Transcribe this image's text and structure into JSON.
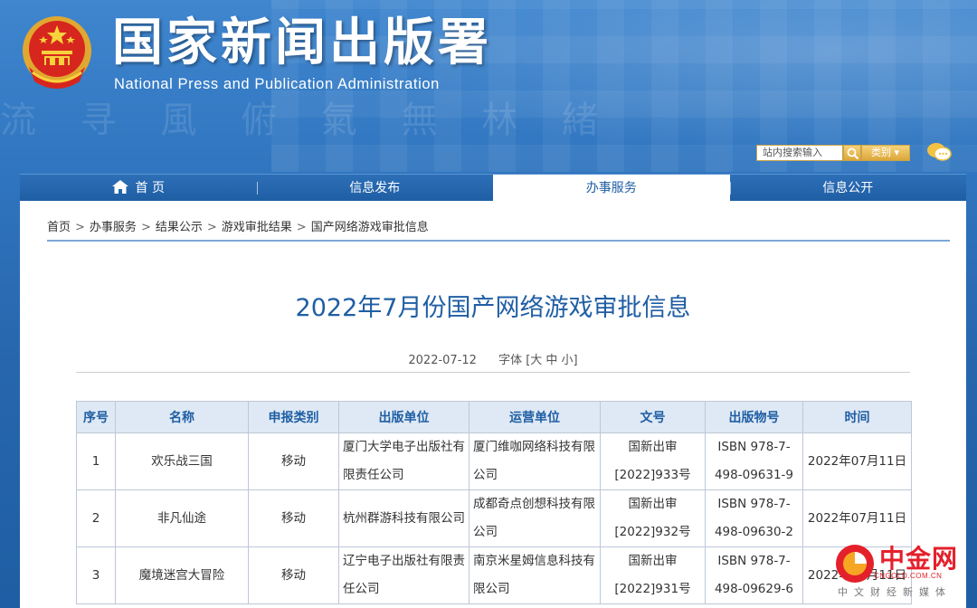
{
  "header": {
    "site_title": "国家新闻出版署",
    "site_subtitle": "National Press and Publication Administration",
    "search_placeholder": "站内搜索输入",
    "category_label": "类别 ▾"
  },
  "nav": {
    "items": [
      {
        "label": "首 页"
      },
      {
        "label": "信息发布"
      },
      {
        "label": "办事服务"
      },
      {
        "label": "信息公开"
      }
    ],
    "active_index": 2
  },
  "breadcrumb": [
    "首页",
    "办事服务",
    "结果公示",
    "游戏审批结果",
    "国产网络游戏审批信息"
  ],
  "breadcrumb_sep": ">",
  "article": {
    "title": "2022年7月份国产网络游戏审批信息",
    "date": "2022-07-12",
    "font_label": "字体 [大 中 小]"
  },
  "table": {
    "headers": [
      "序号",
      "名称",
      "申报类别",
      "出版单位",
      "运营单位",
      "文号",
      "出版物号",
      "时间"
    ],
    "rows": [
      [
        "1",
        "欢乐战三国",
        "移动",
        "厦门大学电子出版社有限责任公司",
        "厦门维咖网络科技有限公司",
        "国新出审[2022]933号",
        "ISBN 978-7-498-09631-9",
        "2022年07月11日"
      ],
      [
        "2",
        "非凡仙途",
        "移动",
        "杭州群游科技有限公司",
        "成都奇点创想科技有限公司",
        "国新出审[2022]932号",
        "ISBN 978-7-498-09630-2",
        "2022年07月11日"
      ],
      [
        "3",
        "魔境迷宫大冒险",
        "移动",
        "辽宁电子出版社有限责任公司",
        "南京米星姆信息科技有限公司",
        "国新出审[2022]931号",
        "ISBN 978-7-498-09629-6",
        "2022年07月11日"
      ]
    ]
  },
  "watermark": {
    "brand": "中金网",
    "domain": "CNGOLD.COM.CN",
    "tagline": "中文财经新媒体"
  },
  "colors": {
    "header_blue": "#2766ad",
    "title_blue": "#1f5ea3",
    "table_header_bg": "#dfe9f5",
    "watermark_red": "#e4202b"
  }
}
